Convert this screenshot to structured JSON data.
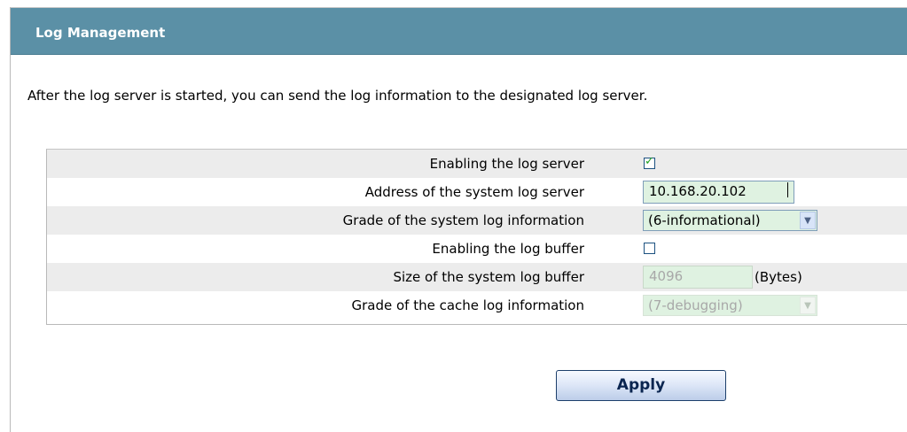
{
  "header": {
    "title": "Log Management"
  },
  "intro": "After the log server is started, you can send the log information to the designated log server.",
  "rows": [
    {
      "label": "Enabling the log server",
      "checked": true
    },
    {
      "label": "Address of the system log server",
      "value": "10.168.20.102"
    },
    {
      "label": "Grade of the system log information",
      "value": "(6-informational)"
    },
    {
      "label": "Enabling the log buffer",
      "checked": false
    },
    {
      "label": "Size of the system log buffer",
      "value": "4096",
      "unit": "(Bytes)"
    },
    {
      "label": "Grade of the cache log information",
      "value": "(7-debugging)"
    }
  ],
  "icons": {
    "dropdown": "chevron-down-icon",
    "check": "checkmark-icon"
  },
  "actions": {
    "apply_label": "Apply"
  },
  "colors": {
    "header_bg": "#5b90a6",
    "field_bg": "#dff2e1",
    "row_shade": "#ececec"
  }
}
